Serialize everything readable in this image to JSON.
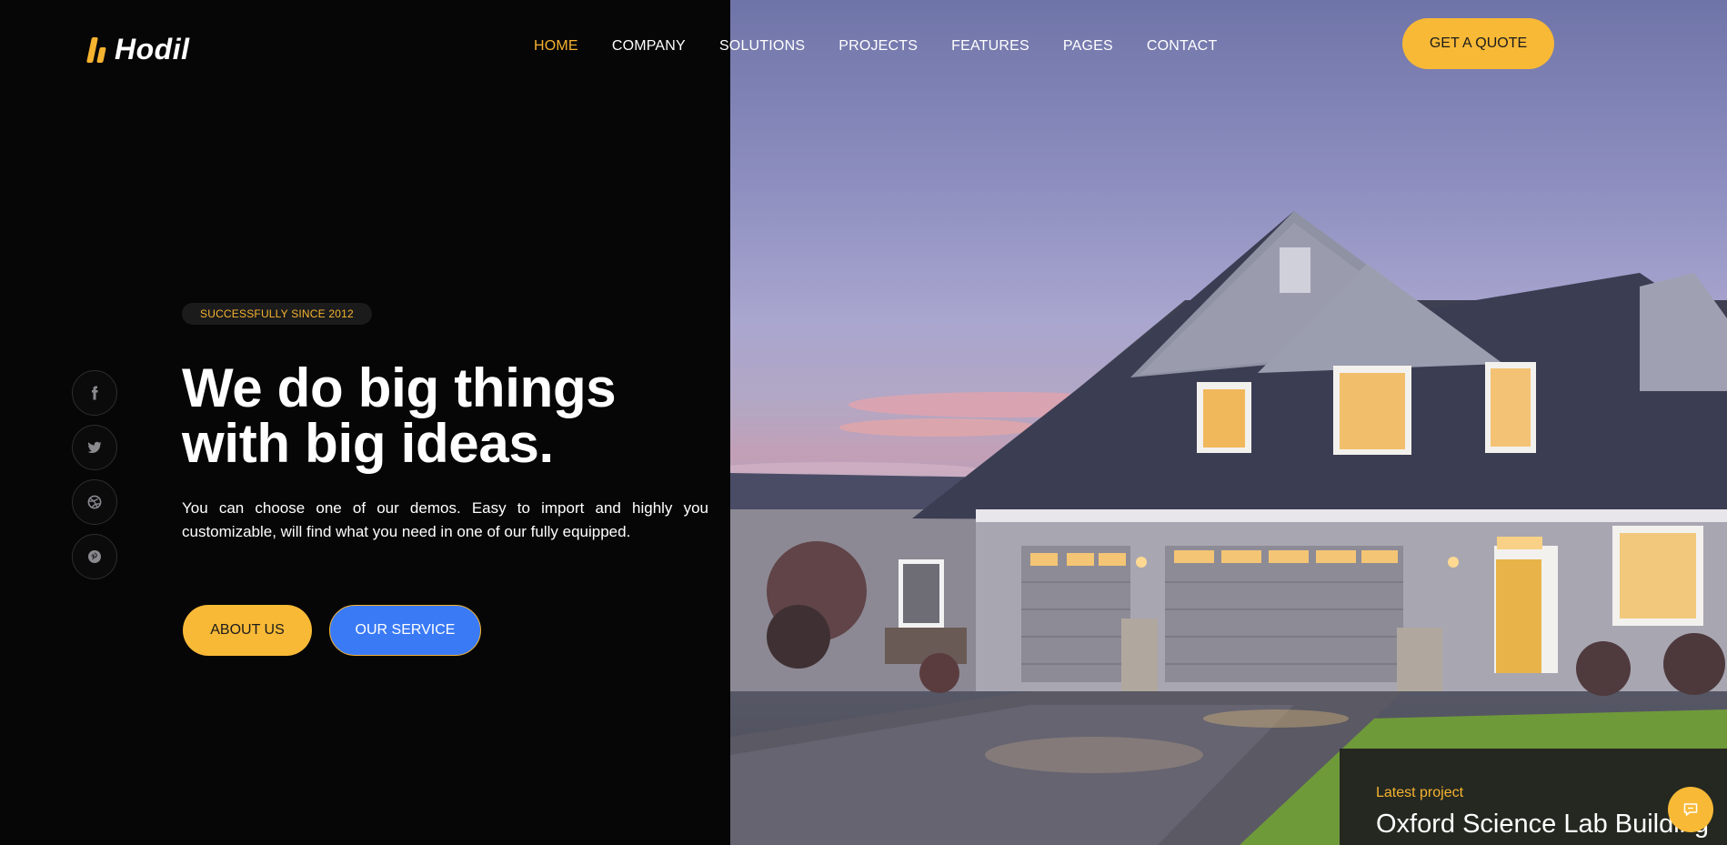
{
  "brand": {
    "name": "Hodil",
    "accent": "#f5b32f",
    "blue": "#3a7af5"
  },
  "nav": {
    "items": [
      {
        "label": "HOME",
        "active": true
      },
      {
        "label": "COMPANY"
      },
      {
        "label": "SOLUTIONS"
      },
      {
        "label": "PROJECTS"
      },
      {
        "label": "FEATURES"
      },
      {
        "label": "PAGES"
      },
      {
        "label": "CONTACT"
      }
    ],
    "cta_label": "GET A QUOTE"
  },
  "social": [
    "facebook-icon",
    "twitter-icon",
    "dribbble-icon",
    "pinterest-icon"
  ],
  "hero": {
    "tagline": "SUCCESSFULLY SINCE 2012",
    "headline": "We do big things with big ideas.",
    "lead": "You can choose one of our demos. Easy to import and highly you customizable, will find what you need in one of our fully equipped.",
    "primary_button": "ABOUT US",
    "secondary_button": "OUR SERVICE"
  },
  "latest_project": {
    "label": "Latest project",
    "title": "Oxford Science Lab Building"
  }
}
